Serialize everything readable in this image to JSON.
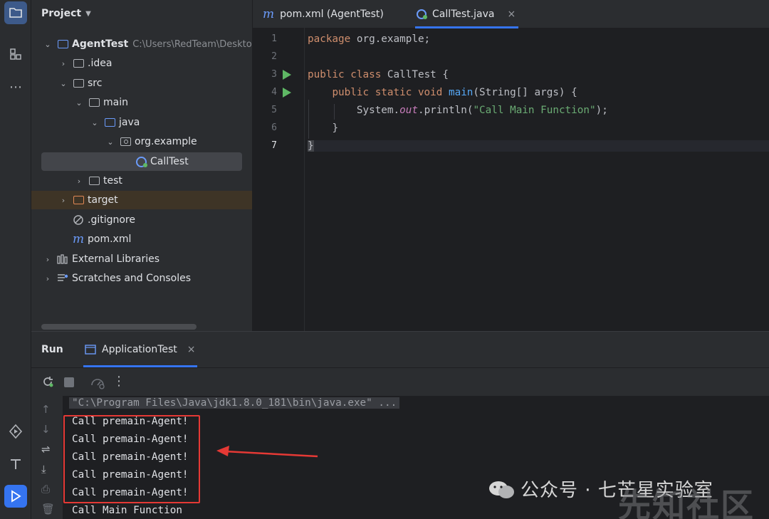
{
  "project_panel": {
    "title": "Project",
    "tree": [
      {
        "label": "AgentTest",
        "path": "C:\\Users\\RedTeam\\Deskto"
      },
      {
        "label": ".idea"
      },
      {
        "label": "src"
      },
      {
        "label": "main"
      },
      {
        "label": "java"
      },
      {
        "label": "org.example"
      },
      {
        "label": "CallTest"
      },
      {
        "label": "test"
      },
      {
        "label": "target"
      },
      {
        "label": ".gitignore"
      },
      {
        "label": "pom.xml"
      },
      {
        "label": "External Libraries"
      },
      {
        "label": "Scratches and Consoles"
      }
    ]
  },
  "editor": {
    "tabs": [
      {
        "label": "pom.xml (AgentTest)"
      },
      {
        "label": "CallTest.java",
        "close": "×"
      }
    ],
    "line_numbers": [
      "1",
      "2",
      "3",
      "4",
      "5",
      "6",
      "7"
    ],
    "code": {
      "l1_kw": "package",
      "l1_rest": " org.example;",
      "l3_kw1": "public",
      "l3_kw2": "class",
      "l3_rest": " CallTest {",
      "l4_kw": "public static void",
      "l4_fn": "main",
      "l4_rest": "(String[] args) {",
      "l5_a": "System.",
      "l5_static": "out",
      "l5_b": ".println(",
      "l5_str": "\"Call Main Function\"",
      "l5_c": ");",
      "l6": "}",
      "l7": "}"
    }
  },
  "run_panel": {
    "title": "Run",
    "tab_label": "ApplicationTest",
    "tab_close": "×",
    "console": [
      "\"C:\\Program Files\\Java\\jdk1.8.0_181\\bin\\java.exe\" ...",
      "Call premain-Agent!",
      "Call premain-Agent!",
      "Call premain-Agent!",
      "Call premain-Agent!",
      "Call premain-Agent!",
      "Call Main Function"
    ]
  },
  "watermark": {
    "text": "公众号 · 七芒星实验室",
    "sub": "先知社区"
  },
  "colors": {
    "accent": "#3574f0",
    "highlight": "#e53935",
    "keyword": "#cf8e6d",
    "function": "#56a8f5",
    "string": "#6aab73"
  }
}
